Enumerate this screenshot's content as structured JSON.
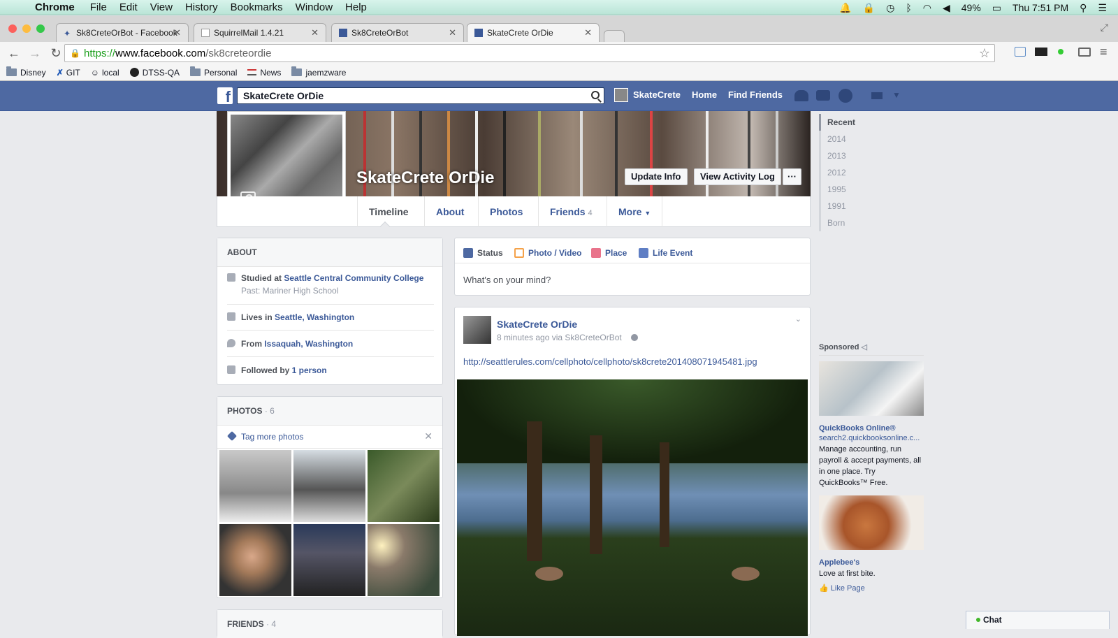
{
  "macos_menubar": {
    "app": "Chrome",
    "menus": [
      "File",
      "Edit",
      "View",
      "History",
      "Bookmarks",
      "Window",
      "Help"
    ],
    "battery": "49%",
    "clock": "Thu 7:51 PM"
  },
  "browser": {
    "tabs": [
      {
        "title": "Sk8CreteOrBot - Facebook"
      },
      {
        "title": "SquirrelMail 1.4.21"
      },
      {
        "title": "Sk8CreteOrBot"
      },
      {
        "title": "SkateCrete OrDie"
      }
    ],
    "url": {
      "scheme": "https://",
      "host": "www.facebook.com",
      "path": "/sk8creteordie"
    },
    "bookmarks": [
      "Disney",
      "GIT",
      "local",
      "DTSS-QA",
      "Personal",
      "News",
      "jaemzware"
    ]
  },
  "facebook": {
    "search_value": "SkateCrete OrDie",
    "nav": {
      "user": "SkateCrete",
      "home": "Home",
      "find_friends": "Find Friends"
    },
    "profile": {
      "name": "SkateCrete OrDie",
      "update_info": "Update Info",
      "activity_log": "View Activity Log",
      "more_dots": "···"
    },
    "tabs": {
      "timeline": "Timeline",
      "about": "About",
      "photos": "Photos",
      "friends": "Friends",
      "friends_count": "4",
      "more": "More"
    },
    "about": {
      "heading": "ABOUT",
      "studied_prefix": "Studied at ",
      "studied_school": "Seattle Central Community College",
      "studied_past": "Past: Mariner High School",
      "lives_prefix": "Lives in ",
      "lives_place": "Seattle, Washington",
      "from_prefix": "From ",
      "from_place": "Issaquah, Washington",
      "followed_prefix": "Followed by ",
      "followed_count": "1 person"
    },
    "photos_card": {
      "heading": "PHOTOS",
      "count": "· 6",
      "tag_more": "Tag more photos"
    },
    "friends_card": {
      "heading": "FRIENDS",
      "count": "· 4"
    },
    "composer": {
      "status": "Status",
      "photo_video": "Photo / Video",
      "place": "Place",
      "life_event": "Life Event",
      "placeholder": "What's on your mind?"
    },
    "post": {
      "author": "SkateCrete OrDie",
      "meta": "8 minutes ago via Sk8CreteOrBot",
      "link": "http://seattlerules.com/cellphoto/cellphoto/sk8crete201408071945481.jpg"
    },
    "timeline_years": [
      "Recent",
      "2014",
      "2013",
      "2012",
      "1995",
      "1991",
      "Born"
    ],
    "sponsored": {
      "heading": "Sponsored",
      "ads": [
        {
          "title": "QuickBooks Online®",
          "url": "search2.quickbooksonline.c...",
          "text": "Manage accounting, run payroll & accept payments, all in one place. Try QuickBooks™ Free."
        },
        {
          "title": "Applebee's",
          "text": "Love at first bite.",
          "like": "Like Page"
        }
      ]
    },
    "chat": "Chat"
  },
  "colors": {
    "fb_blue": "#4e69a2",
    "link": "#3b5998",
    "page_bg": "#e9eaed"
  }
}
